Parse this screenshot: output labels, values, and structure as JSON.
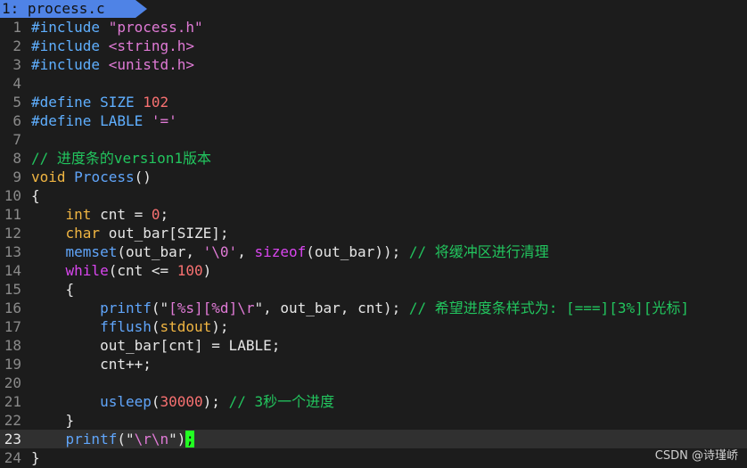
{
  "tab": {
    "label": "1: process.c"
  },
  "lines": [
    {
      "n": "1",
      "segs": [
        {
          "t": "#include ",
          "c": "pp"
        },
        {
          "t": "\"process.h\"",
          "c": "str"
        }
      ]
    },
    {
      "n": "2",
      "segs": [
        {
          "t": "#include ",
          "c": "pp"
        },
        {
          "t": "<string.h>",
          "c": "str"
        }
      ]
    },
    {
      "n": "3",
      "segs": [
        {
          "t": "#include ",
          "c": "pp"
        },
        {
          "t": "<unistd.h>",
          "c": "str"
        }
      ]
    },
    {
      "n": "4",
      "segs": []
    },
    {
      "n": "5",
      "segs": [
        {
          "t": "#define SIZE ",
          "c": "pp"
        },
        {
          "t": "102",
          "c": "num"
        }
      ]
    },
    {
      "n": "6",
      "segs": [
        {
          "t": "#define LABLE ",
          "c": "pp"
        },
        {
          "t": "'='",
          "c": "str"
        }
      ]
    },
    {
      "n": "7",
      "segs": []
    },
    {
      "n": "8",
      "segs": [
        {
          "t": "// 进度条的version1版本",
          "c": "cm"
        }
      ]
    },
    {
      "n": "9",
      "segs": [
        {
          "t": "void",
          "c": "ty"
        },
        {
          "t": " "
        },
        {
          "t": "Process",
          "c": "fn"
        },
        {
          "t": "()"
        }
      ]
    },
    {
      "n": "10",
      "segs": [
        {
          "t": "{"
        }
      ]
    },
    {
      "n": "11",
      "segs": [
        {
          "t": "    "
        },
        {
          "t": "int",
          "c": "ty"
        },
        {
          "t": " cnt = "
        },
        {
          "t": "0",
          "c": "num"
        },
        {
          "t": ";"
        }
      ]
    },
    {
      "n": "12",
      "segs": [
        {
          "t": "    "
        },
        {
          "t": "char",
          "c": "ty"
        },
        {
          "t": " out_bar[SIZE];"
        }
      ]
    },
    {
      "n": "13",
      "segs": [
        {
          "t": "    "
        },
        {
          "t": "memset",
          "c": "fn"
        },
        {
          "t": "(out_bar, "
        },
        {
          "t": "'\\0'",
          "c": "str"
        },
        {
          "t": ", "
        },
        {
          "t": "sizeof",
          "c": "kw"
        },
        {
          "t": "(out_bar)); "
        },
        {
          "t": "// 将缓冲区进行清理",
          "c": "cm"
        }
      ]
    },
    {
      "n": "14",
      "segs": [
        {
          "t": "    "
        },
        {
          "t": "while",
          "c": "kw"
        },
        {
          "t": "(cnt <= "
        },
        {
          "t": "100",
          "c": "num"
        },
        {
          "t": ")"
        }
      ]
    },
    {
      "n": "15",
      "segs": [
        {
          "t": "    {"
        }
      ]
    },
    {
      "n": "16",
      "segs": [
        {
          "t": "        "
        },
        {
          "t": "printf",
          "c": "fn"
        },
        {
          "t": "(\"[%s][%d]\\r\", out_bar, cnt); ",
          "c": "mixed16"
        },
        {
          "t": "// 希望进度条样式为: [===][3%][光标]",
          "c": "cm"
        }
      ]
    },
    {
      "n": "17",
      "segs": [
        {
          "t": "        "
        },
        {
          "t": "fflush",
          "c": "fn"
        },
        {
          "t": "("
        },
        {
          "t": "stdout",
          "c": "ty"
        },
        {
          "t": ");"
        }
      ]
    },
    {
      "n": "18",
      "segs": [
        {
          "t": "        out_bar[cnt] = LABLE;"
        }
      ]
    },
    {
      "n": "19",
      "segs": [
        {
          "t": "        cnt++;"
        }
      ]
    },
    {
      "n": "20",
      "segs": []
    },
    {
      "n": "21",
      "segs": [
        {
          "t": "        "
        },
        {
          "t": "usleep",
          "c": "fn"
        },
        {
          "t": "("
        },
        {
          "t": "30000",
          "c": "num"
        },
        {
          "t": "); "
        },
        {
          "t": "// 3秒一个进度",
          "c": "cm"
        }
      ]
    },
    {
      "n": "22",
      "segs": [
        {
          "t": "    }"
        }
      ]
    },
    {
      "n": "23",
      "cursor": true,
      "segs": [
        {
          "t": "    "
        },
        {
          "t": "printf",
          "c": "fn"
        },
        {
          "t": "(\""
        },
        {
          "t": "\\r\\n",
          "c": "str"
        },
        {
          "t": "\")"
        },
        {
          "t": ";",
          "c": "cur"
        }
      ]
    },
    {
      "n": "24",
      "segs": [
        {
          "t": "}"
        }
      ]
    }
  ],
  "watermark": "CSDN @诗瑾峤"
}
